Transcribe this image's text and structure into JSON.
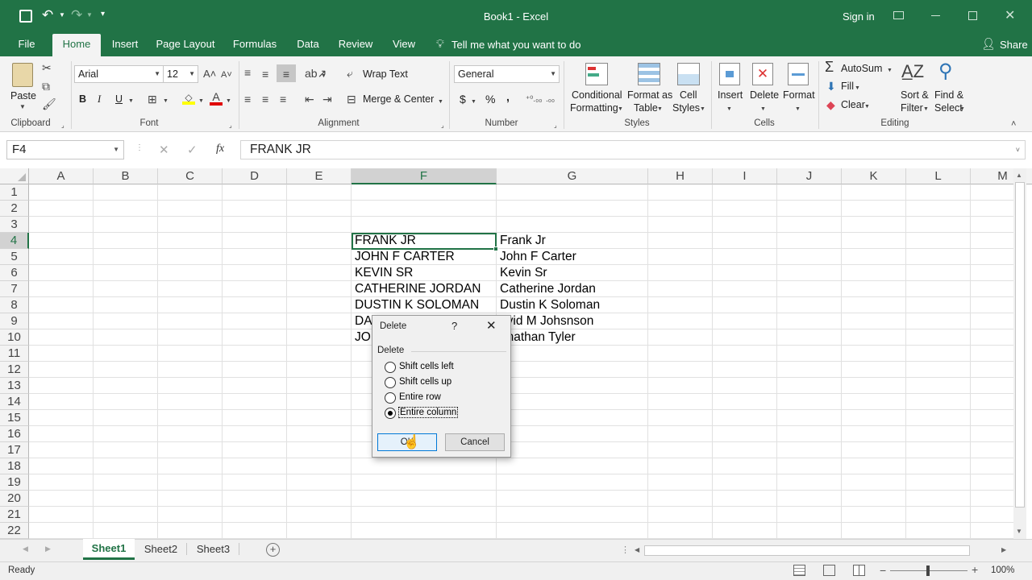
{
  "window": {
    "title": "Book1 - Excel",
    "sign_in": "Sign in",
    "accent": "#217346"
  },
  "tabs": [
    "File",
    "Home",
    "Insert",
    "Page Layout",
    "Formulas",
    "Data",
    "Review",
    "View"
  ],
  "tell_me": "Tell me what you want to do",
  "share": "Share",
  "ribbon": {
    "clipboard": {
      "label": "Clipboard",
      "paste": "Paste"
    },
    "font": {
      "label": "Font",
      "name": "Arial",
      "size": "12",
      "bold": "B",
      "italic": "I",
      "underline": "U"
    },
    "alignment": {
      "label": "Alignment",
      "wrap": "Wrap Text",
      "merge": "Merge & Center"
    },
    "number": {
      "label": "Number",
      "format": "General",
      "currency": "$",
      "percent": "%",
      "comma": ","
    },
    "styles": {
      "label": "Styles",
      "cond1": "Conditional",
      "cond2": "Formatting",
      "fmt1": "Format as",
      "fmt2": "Table",
      "cell1": "Cell",
      "cell2": "Styles"
    },
    "cells": {
      "label": "Cells",
      "insert": "Insert",
      "delete": "Delete",
      "format": "Format"
    },
    "editing": {
      "label": "Editing",
      "autosum": "AutoSum",
      "fill": "Fill",
      "clear": "Clear",
      "sort1": "Sort &",
      "sort2": "Filter",
      "find1": "Find &",
      "find2": "Select"
    }
  },
  "formula_bar": {
    "name_box": "F4",
    "fx": "fx",
    "content": "FRANK JR"
  },
  "columns": [
    "A",
    "B",
    "C",
    "D",
    "E",
    "F",
    "G",
    "H",
    "I",
    "J",
    "K",
    "L",
    "M"
  ],
  "rows": [
    "1",
    "2",
    "3",
    "4",
    "5",
    "6",
    "7",
    "8",
    "9",
    "10",
    "11",
    "12",
    "13",
    "14",
    "15",
    "16",
    "17",
    "18",
    "19",
    "20",
    "21",
    "22"
  ],
  "cells_F": [
    "FRANK JR",
    "JOHN F CARTER",
    "KEVIN SR",
    "CATHERINE JORDAN",
    "DUSTIN K SOLOMAN",
    "DA",
    "JO"
  ],
  "cells_G": [
    "Frank Jr",
    "John F Carter",
    "Kevin Sr",
    "Catherine Jordan",
    "Dustin K Soloman",
    "avid M Johsnson",
    "onathan Tyler"
  ],
  "dialog": {
    "title": "Delete",
    "help": "?",
    "group": "Delete",
    "options": [
      "Shift cells left",
      "Shift cells up",
      "Entire row",
      "Entire column"
    ],
    "selected": "Entire column",
    "ok": "OK",
    "cancel": "Cancel"
  },
  "sheets": [
    "Sheet1",
    "Sheet2",
    "Sheet3"
  ],
  "status": {
    "ready": "Ready",
    "zoom": "100%"
  }
}
